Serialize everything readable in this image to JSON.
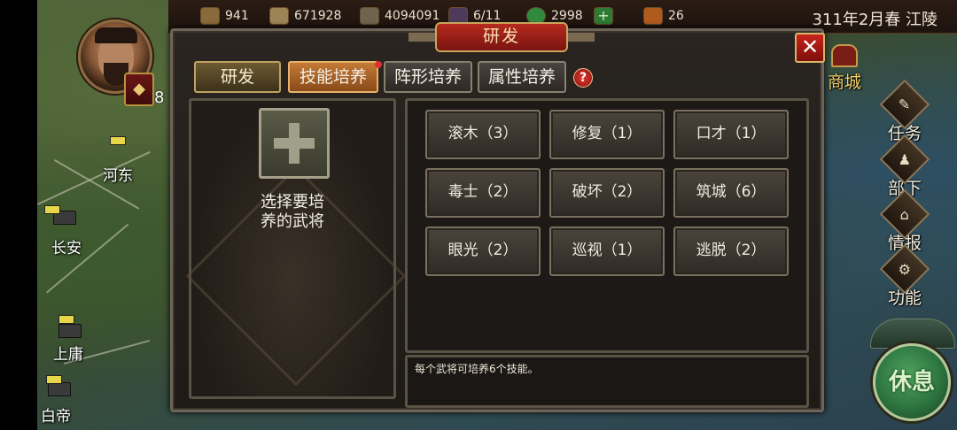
{
  "map": {
    "cities": [
      "河东",
      "长安",
      "上庸",
      "白帝"
    ]
  },
  "topbar": {
    "resources": [
      {
        "icon": "gold-icon",
        "value": "941"
      },
      {
        "icon": "food-icon",
        "value": "671928"
      },
      {
        "icon": "troops-icon",
        "value": "4094091"
      },
      {
        "icon": "generals-icon",
        "value": "6/11"
      },
      {
        "icon": "gem-icon",
        "value": "2998"
      },
      {
        "icon": "add-icon",
        "value": ""
      },
      {
        "icon": "token-icon",
        "value": "26"
      }
    ],
    "date_location": "311年2月春 江陵"
  },
  "player": {
    "level": "8",
    "rank_icon": "rank-badge-icon"
  },
  "side_menu": {
    "shop": "商城",
    "quest": "任务",
    "subordinates": "部下",
    "intel": "情报",
    "functions": "功能",
    "rest": "休息"
  },
  "panel": {
    "title": "研发",
    "close": "✕",
    "tabs": [
      "研发",
      "技能培养",
      "阵形培养",
      "属性培养"
    ],
    "help": "?",
    "select_general": [
      "选择要培",
      "养的武将"
    ],
    "skills": [
      "滚木（3）",
      "修复（1）",
      "口才（1）",
      "毒士（2）",
      "破坏（2）",
      "筑城（6）",
      "眼光（2）",
      "巡视（1）",
      "逃脱（2）"
    ],
    "hint": "每个武将可培养6个技能。"
  },
  "colors": {
    "accent_red": "#b62a20",
    "tab_active": "#c47a36",
    "panel_bg": "#221e1a",
    "rest_green": "#2d7440"
  }
}
